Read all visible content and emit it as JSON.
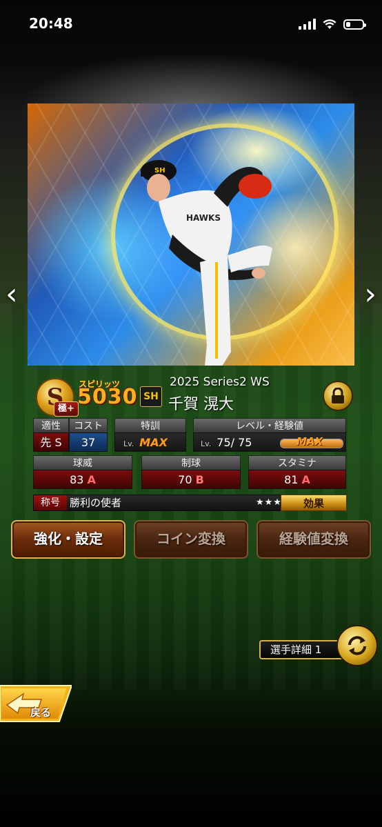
{
  "status_bar": {
    "time": "20:48"
  },
  "card": {
    "rank": "S",
    "rank_sub": "極+",
    "spirits_label": "スピリッツ",
    "spirits_value": "5030",
    "team_logo": "SH",
    "series": "2025 Series2 WS",
    "player_name": "千賀 滉大"
  },
  "stats": {
    "aptitude_header": "適性",
    "aptitude_value": "先 S",
    "cost_header": "コスト",
    "cost_value": "37",
    "training_header": "特訓",
    "training_lv": "Lv.",
    "training_value": "MAX",
    "level_header": "レベル・経験値",
    "level_lv": "Lv.",
    "level_value": "75/ 75",
    "exp_value": "MAX",
    "exp_fraction": 1.0,
    "velocity_header": "球威",
    "velocity_value": "83",
    "velocity_grade": "A",
    "control_header": "制球",
    "control_value": "70",
    "control_grade": "B",
    "stamina_header": "スタミナ",
    "stamina_value": "81",
    "stamina_grade": "A"
  },
  "title_row": {
    "tag": "称号",
    "text": "勝利の使者",
    "stars": "★★★",
    "effect_button": "効果"
  },
  "actions": {
    "strengthen": "強化・設定",
    "coin_convert": "コイン変換",
    "exp_convert": "経験値変換"
  },
  "detail": {
    "label": "選手詳細 1"
  },
  "back": {
    "label": "戻る"
  },
  "colors": {
    "accent_gold": "#e3b15a",
    "spirits_orange": "#ffb01f",
    "grade_red": "#ff6b6b"
  }
}
